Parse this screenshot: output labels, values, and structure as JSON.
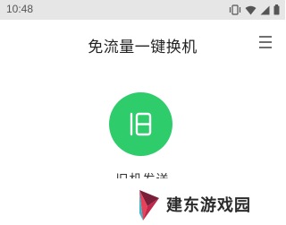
{
  "status_bar": {
    "time": "10:48",
    "icons": [
      "vibrate-icon",
      "wifi-icon",
      "signal-icon",
      "battery-icon"
    ]
  },
  "header": {
    "title": "免流量一键换机",
    "menu_icon": "hamburger-menu-icon"
  },
  "main": {
    "device_button_icon": "old-phone-icon",
    "device_button_color": "#2fcc6c",
    "caption": "旧机发送"
  },
  "watermark": {
    "text": "建东游戏园"
  }
}
